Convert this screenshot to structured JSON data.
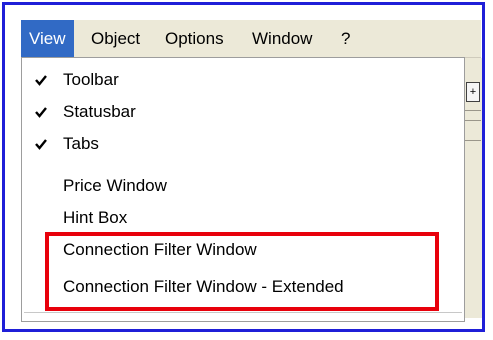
{
  "menubar": {
    "items": [
      "View",
      "Object",
      "Options",
      "Window",
      "?"
    ]
  },
  "view_menu": {
    "items": [
      {
        "label": "Toolbar",
        "checked": true
      },
      {
        "label": "Statusbar",
        "checked": true
      },
      {
        "label": "Tabs",
        "checked": true
      },
      {
        "label": "Price Window",
        "checked": false
      },
      {
        "label": "Hint Box",
        "checked": false
      },
      {
        "label": "Connection Filter Window",
        "checked": false
      },
      {
        "label": "Connection Filter Window - Extended",
        "checked": false
      }
    ]
  },
  "colors": {
    "frame_border": "#1f1fd8",
    "highlight_border": "#e8000b",
    "menu_active_bg": "#316ac5"
  }
}
